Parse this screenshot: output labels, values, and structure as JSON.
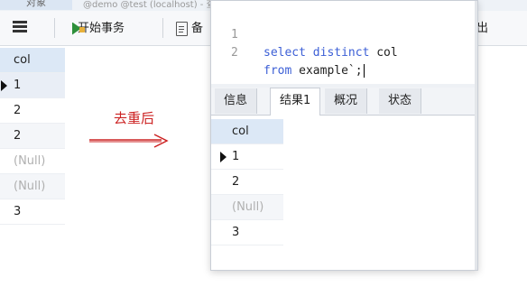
{
  "tabstrip": {
    "active_tab": "对象",
    "faded_tab": "@demo @test (localhost) - 查询 - example @test (localhost)"
  },
  "toolbar": {
    "start_transaction": "开始事务",
    "backup": "备",
    "exit": "出"
  },
  "left_grid": {
    "header": "col",
    "rows": [
      "1",
      "2",
      "2",
      "(Null)",
      "(Null)",
      "3"
    ]
  },
  "annotation": {
    "label": "去重后",
    "color": "#cc2222"
  },
  "editor": {
    "lines": [
      {
        "num": "1",
        "kw1": "select distinct",
        "rest": " col"
      },
      {
        "num": "2",
        "kw1": "from",
        "rest": " example`;"
      }
    ]
  },
  "result_tabs": [
    "信息",
    "结果1",
    "概况",
    "状态"
  ],
  "active_result_tab": "结果1",
  "popup_grid": {
    "header": "col",
    "rows": [
      "1",
      "2",
      "(Null)",
      "3"
    ]
  }
}
